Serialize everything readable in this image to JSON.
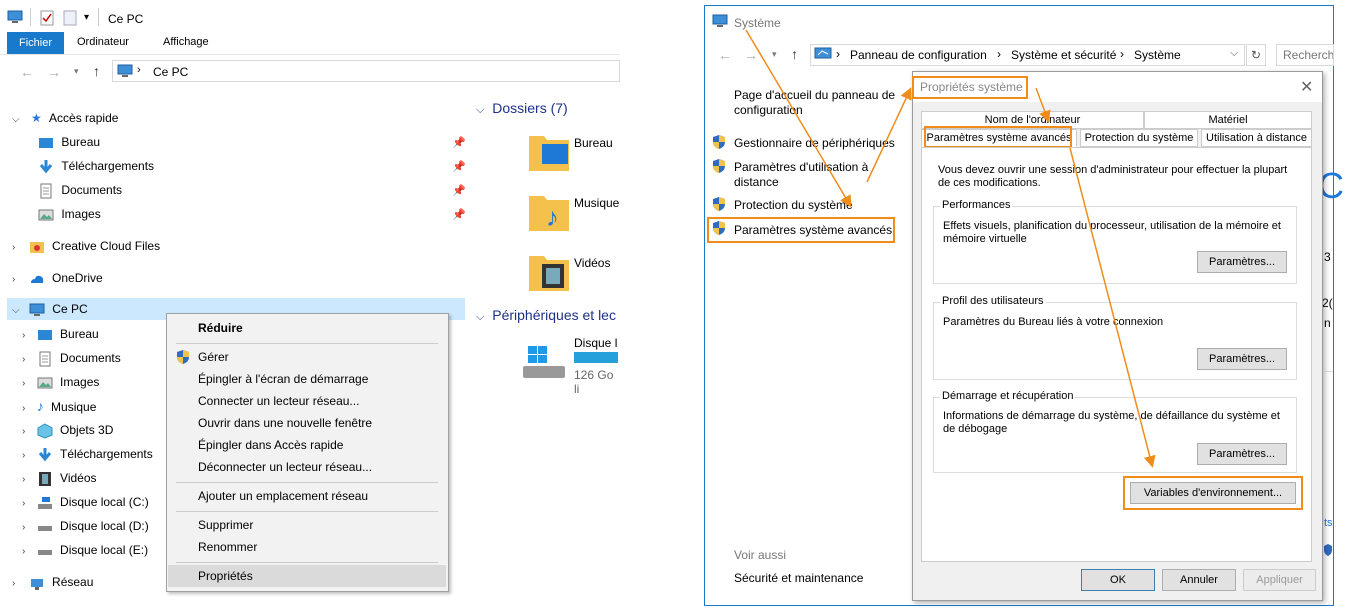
{
  "explorer": {
    "title": "Ce PC",
    "ribbon_tabs": [
      "Fichier",
      "Ordinateur",
      "Affichage"
    ],
    "address": "Ce PC",
    "quick_access": "Accès rapide",
    "quick_items": [
      "Bureau",
      "Téléchargements",
      "Documents",
      "Images"
    ],
    "creative_cloud": "Creative Cloud Files",
    "onedrive": "OneDrive",
    "this_pc": "Ce PC",
    "pc_items": [
      "Bureau",
      "Documents",
      "Images",
      "Musique",
      "Objets 3D",
      "Téléchargements",
      "Vidéos",
      "Disque local (C:)",
      "Disque local (D:)",
      "Disque local (E:)"
    ],
    "network": "Réseau",
    "folders_header": "Dossiers (7)",
    "folders": [
      "Bureau",
      "Musique",
      "Vidéos"
    ],
    "devices_header": "Périphériques et lec",
    "disk_name": "Disque l",
    "disk_free": "126 Go li"
  },
  "context_menu": {
    "collapse": "Réduire",
    "items1": [
      "Gérer",
      "Épingler à l'écran de démarrage",
      "Connecter un lecteur réseau...",
      "Ouvrir dans une nouvelle fenêtre",
      "Épingler dans Accès rapide",
      "Déconnecter un lecteur réseau..."
    ],
    "add_network": "Ajouter un emplacement réseau",
    "delete": "Supprimer",
    "rename": "Renommer",
    "properties": "Propriétés"
  },
  "system": {
    "title": "Système",
    "breadcrumb": [
      "Panneau de configuration",
      "Système et sécurité",
      "Système"
    ],
    "search": "Recherch",
    "home_link": "Page d'accueil du panneau de configuration",
    "links": [
      "Gestionnaire de périphériques",
      "Paramètres d'utilisation à distance",
      "Protection du système",
      "Paramètres système avancés"
    ],
    "see_also": "Voir aussi",
    "security": "Sécurité et maintenance"
  },
  "dialog": {
    "title": "Propriétés système",
    "tabs_top": [
      "Nom de l'ordinateur",
      "Matériel"
    ],
    "tabs_bottom": [
      "Paramètres système avancés",
      "Protection du système",
      "Utilisation à distance"
    ],
    "admin_note": "Vous devez ouvrir une session d'administrateur pour effectuer la plupart de ces modifications.",
    "perf_title": "Performances",
    "perf_text": "Effets visuels, planification du processeur, utilisation de la mémoire et mémoire virtuelle",
    "profile_title": "Profil des utilisateurs",
    "profile_text": "Paramètres du Bureau liés à votre connexion",
    "startup_title": "Démarrage et récupération",
    "startup_text": "Informations de démarrage du système, de défaillance du système et de débogage",
    "settings_btn": "Paramètres...",
    "env_btn": "Variables d'environnement...",
    "ok": "OK",
    "cancel": "Annuler",
    "apply": "Appliquer"
  },
  "accent": "#f08c1a"
}
